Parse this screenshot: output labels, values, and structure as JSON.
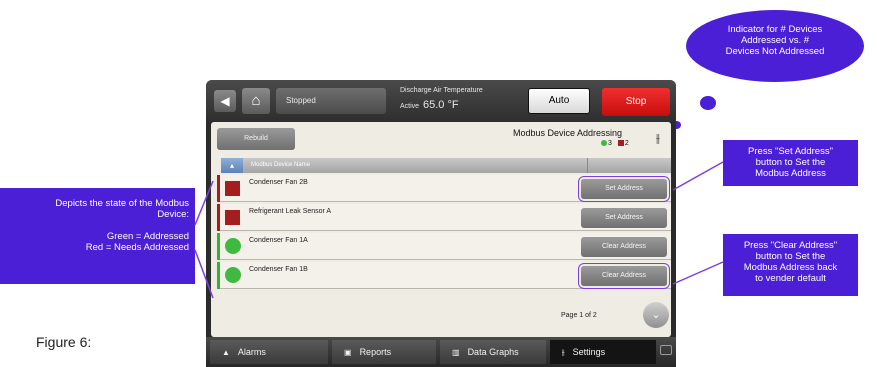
{
  "topbar": {
    "status": "Stopped",
    "temp_label": "Discharge Air Temperature",
    "temp_state": "Active",
    "temp_value": "65.0 °F",
    "auto_label": "Auto",
    "stop_label": "Stop"
  },
  "panel": {
    "rebuild_label": "Rebuild",
    "title": "Modbus Device Addressing",
    "count_addressed": "3",
    "count_not_addressed": "2",
    "column_header": "Modbus Device Name",
    "page_indicator": "Page 1 of 2"
  },
  "rows": [
    {
      "name": "Condenser Fan 2B",
      "state": "needs-addressed",
      "button": "Set Address"
    },
    {
      "name": "Refrigerant Leak Sensor A",
      "state": "needs-addressed",
      "button": "Set Address"
    },
    {
      "name": "Condenser Fan 1A",
      "state": "addressed",
      "button": "Clear Address"
    },
    {
      "name": "Condenser Fan 1B",
      "state": "addressed",
      "button": "Clear Address"
    }
  ],
  "bottom_nav": [
    {
      "label": "Alarms",
      "icon": "bell-icon"
    },
    {
      "label": "Reports",
      "icon": "document-icon"
    },
    {
      "label": "Data Graphs",
      "icon": "chart-icon"
    },
    {
      "label": "Settings",
      "icon": "sliders-icon"
    }
  ],
  "annotations": {
    "cloud_l1": "Indicator for # Devices",
    "cloud_l2": "Addressed vs. #",
    "cloud_l3": "Devices Not Addressed",
    "set_l1": "Press \"Set Address\"",
    "set_l2": "button to Set the",
    "set_l3": "Modbus Address",
    "clear_l1": "Press \"Clear Address\"",
    "clear_l2": "button to Set the",
    "clear_l3": "Modbus Address back",
    "clear_l4": "to vender default",
    "state_l1": "Depicts the state of the Modbus",
    "state_l2": "Device:",
    "state_l3": "Green = Addressed",
    "state_l4": "Red = Needs Addressed"
  },
  "caption": "Figure 6:",
  "colors": {
    "callout": "#4b1fd6",
    "addressed": "#3fb93f",
    "needs_addressed": "#a51e1e",
    "stop": "#e01e1e"
  }
}
